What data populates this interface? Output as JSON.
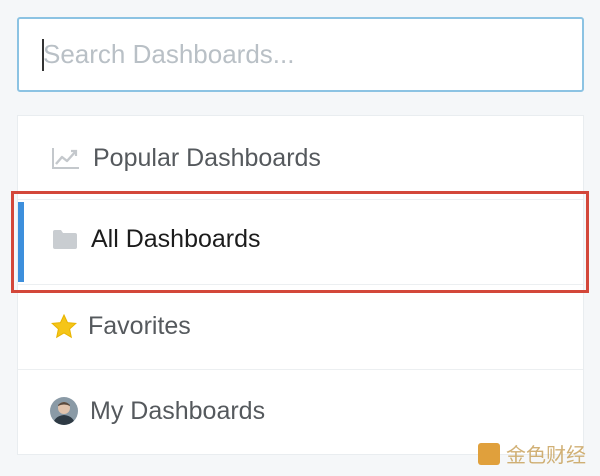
{
  "search": {
    "placeholder": "Search Dashboards..."
  },
  "menu": {
    "items": [
      {
        "label": "Popular Dashboards",
        "icon": "trend-chart-icon"
      },
      {
        "label": "All Dashboards",
        "icon": "folder-icon",
        "active": true
      },
      {
        "label": "Favorites",
        "icon": "star-icon"
      },
      {
        "label": "My Dashboards",
        "icon": "user-avatar"
      }
    ]
  },
  "colors": {
    "accent": "#3d8fdc",
    "highlight": "#d3473a",
    "search_border": "#8cc3e3",
    "star": "#f5c518"
  },
  "watermark": {
    "text": "金色财经"
  }
}
